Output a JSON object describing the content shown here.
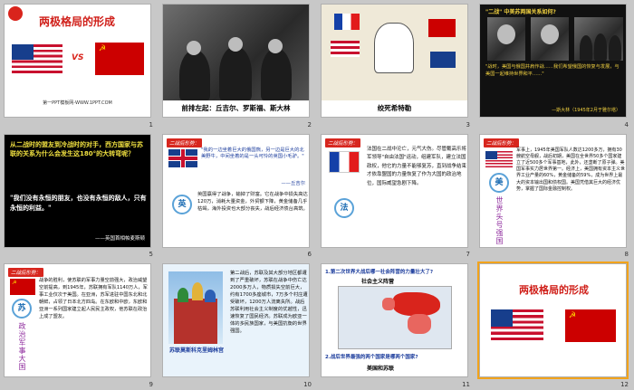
{
  "slides": [
    {
      "num": "1",
      "title": "两极格局的形成",
      "vs": "VS",
      "footer": "第一PPT模板网-WWW.1PPT.COM"
    },
    {
      "num": "2",
      "caption": "前排左起：丘吉尔、罗斯福、斯大林"
    },
    {
      "num": "3",
      "caption": "绞死希特勒"
    },
    {
      "num": "4",
      "heading": "\"二战\" 中美苏两国关系如何?",
      "quote": "\"战时，美国与俄国并肩作战……我们希望俄国的恢复与发展，与美国一起维持世界和平……\"",
      "source": "—斯大林（1945年2月于雅尔塔）"
    },
    {
      "num": "5",
      "question": "从二战时的盟友到冷战时的对手，西方国家与苏联的关系为什么会发生这180°的大转弯呢？",
      "quote": "\"我们没有永恒的朋友，也没有永恒的敌人，只有永恒的利益。\"",
      "source": "——英国首相帕麦斯顿"
    },
    {
      "num": "6",
      "tag": "二战后形势：",
      "quote": "\"我的一边坐着巨大的俄国熊，另一边是巨大的北美野牛，中间坐着的是一头可怜的英国小毛驴。\"",
      "source": "——丘吉尔",
      "circle": "英",
      "body": "英国赢得了战争，输掉了财富。它在战争中损失高达120万，消耗大量资金，外贸额下降，黄金储备几乎枯竭，海外投资也大部分丧失，战后经济债台高筑。"
    },
    {
      "num": "7",
      "tag": "二战后形势：",
      "circle": "法",
      "body": "法国在二战中沦亡，元气大伤。尽管戴高乐将军领导\"自由法国\"运动，组建军队，建立法国政权，他它的力量不能够复苏，直到战争结束才依靠盟国的力量恢复了作为大国的政治地位，国际威望急剧下降。"
    },
    {
      "num": "8",
      "tag": "二战后形势：",
      "circle": "美",
      "vtext": "世界头号强国",
      "body": "军事上，1945年美国军队人数达1200多万，拥有30艘航空母舰，战后初期，美国在全世界50多个国家建立了近500多个军事基地，此外，还垄断了原子弹。美国军事实力居世界第一。经济上，美国拥有资本主义世界工业产量的60%，黄金储备的59%，成为世界上最大的资本输出国和债权国。美国凭借其巨大的经济优势，掌握了国际金融控制权。"
    },
    {
      "num": "9",
      "tag": "二战后形势：",
      "circle": "苏",
      "vtext": "政治军事大国",
      "body": "战争的胜利，使苏联的军事力量空前强大，政治威望空前提高，到1945年，苏联拥有军队1140万人，军事工业仅次于美国。在亚洲，苏军进驻中国东北和北朝鲜，占领了日本北方四岛。在东欧和中欧，东欧和亚洲一系列国家建立起人民民主政权，他苏联在政治上成了盟友。"
    },
    {
      "num": "10",
      "caption": "苏联莫斯科克里姆林宫",
      "body": "第二战后，苏联及其大部分地区都遭到了严重破坏，苏联在战争中伤亡达2000多万人，物质损失空前巨大，约有1700多座城市，7万多个村庄遭受破坏，1200万人流离失所。战后苏联利用社会主义制度的优越性，迅速恢复了国民经济。苏联成为欧亚一体的多民族国家，与美国抗衡的世界强国。"
    },
    {
      "num": "11",
      "q1": "1.第二次世界大战后哪一社会阵营的力量壮大了?",
      "label1": "社会主义阵营",
      "q2": "2.战后世界最强的两个国家是哪两个国家?",
      "label2": "美国和苏联"
    },
    {
      "num": "12",
      "title": "两极格局的形成"
    }
  ]
}
